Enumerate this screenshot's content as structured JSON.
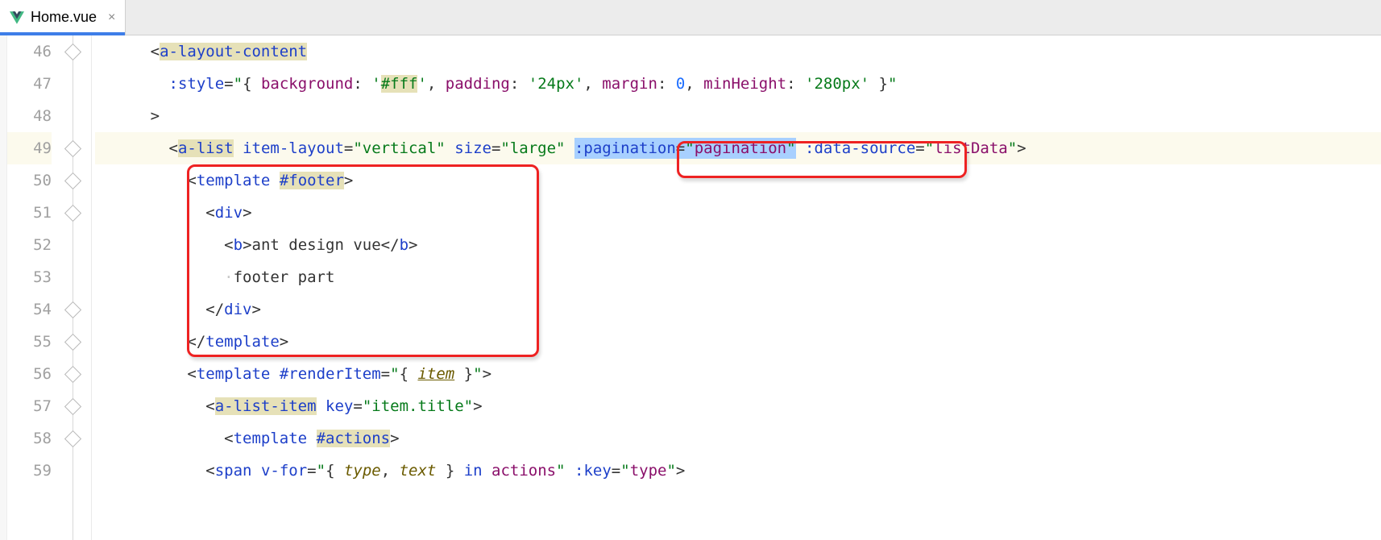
{
  "tab": {
    "filename": "Home.vue",
    "close": "×"
  },
  "lines": {
    "n46": "46",
    "n47": "47",
    "n48": "48",
    "n49": "49",
    "n50": "50",
    "n51": "51",
    "n52": "52",
    "n53": "53",
    "n54": "54",
    "n55": "55",
    "n56": "56",
    "n57": "57",
    "n58": "58",
    "n59": "59"
  },
  "code": {
    "l46": {
      "indent": "      ",
      "open": "<",
      "tag": "a-layout-content"
    },
    "l47": {
      "indent": "        ",
      "attr": ":style",
      "eq": "=",
      "q": "\"",
      "b1": "{ ",
      "k1": "background",
      "c1": ": ",
      "v1": "'",
      "v1b": "#fff",
      "v1c": "'",
      "sep1": ", ",
      "k2": "padding",
      "c2": ": ",
      "v2": "'24px'",
      "sep2": ", ",
      "k3": "margin",
      "c3": ": ",
      "v3": "0",
      "sep3": ", ",
      "k4": "minHeight",
      "c4": ": ",
      "v4": "'280px'",
      "b2": " }",
      "q2": "\""
    },
    "l48": {
      "indent": "      ",
      "close": ">"
    },
    "l49": {
      "indent": "        ",
      "open": "<",
      "tag": "a-list",
      "sp1": " ",
      "a1": "item-layout",
      "eq1": "=",
      "v1": "\"vertical\"",
      "sp2": " ",
      "a2": "size",
      "eq2": "=",
      "v2": "\"large\"",
      "sp3": " ",
      "sela": ":pagination",
      "seleq": "=",
      "selq1": "\"",
      "selv": "pagination",
      "selq2": "\"",
      "sp4": " ",
      "a3": ":data-source",
      "eq3": "=",
      "v3q1": "\"",
      "v3": "listData",
      "v3q2": "\"",
      "end": ">"
    },
    "l50": {
      "indent": "          ",
      "open": "<",
      "tag": "template",
      "sp": " ",
      "slot": "#footer",
      "end": ">"
    },
    "l51": {
      "indent": "            ",
      "open": "<",
      "tag": "div",
      "end": ">"
    },
    "l52": {
      "indent": "              ",
      "o1": "<",
      "t1": "b",
      "c1": ">",
      "txt": "ant design vue",
      "o2": "</",
      "t2": "b",
      "c2": ">"
    },
    "l53": {
      "indent": "              ",
      "dot": "·",
      "txt": "footer part"
    },
    "l54": {
      "indent": "            ",
      "open": "</",
      "tag": "div",
      "end": ">"
    },
    "l55": {
      "indent": "          ",
      "open": "</",
      "tag": "template",
      "end": ">"
    },
    "l56": {
      "indent": "          ",
      "open": "<",
      "tag": "template",
      "sp": " ",
      "slot": "#renderItem",
      "eq": "=",
      "q1": "\"",
      "b1": "{ ",
      "item": "item",
      "b2": " }",
      "q2": "\"",
      "end": ">"
    },
    "l57": {
      "indent": "            ",
      "open": "<",
      "tag": "a-list-item",
      "sp": " ",
      "attr": "key",
      "eq": "=",
      "val": "\"item.title\"",
      "end": ">"
    },
    "l58": {
      "indent": "              ",
      "open": "<",
      "tag": "template",
      "sp": " ",
      "slot": "#actions",
      "end": ">"
    },
    "l59": {
      "indent": "            ",
      "open": "<",
      "tag": "span",
      "sp1": " ",
      "a1": "v-for",
      "eq1": "=",
      "q1": "\"",
      "b1": "{ ",
      "k1": "type",
      "sep": ", ",
      "k2": "text",
      "b2": " } ",
      "in": "in",
      "sp2": " ",
      "var": "actions",
      "q2": "\"",
      "sp3": " ",
      "a2": ":key",
      "eq2": "=",
      "q3": "\"",
      "v2": "type",
      "q4": "\"",
      "end": ">"
    }
  }
}
